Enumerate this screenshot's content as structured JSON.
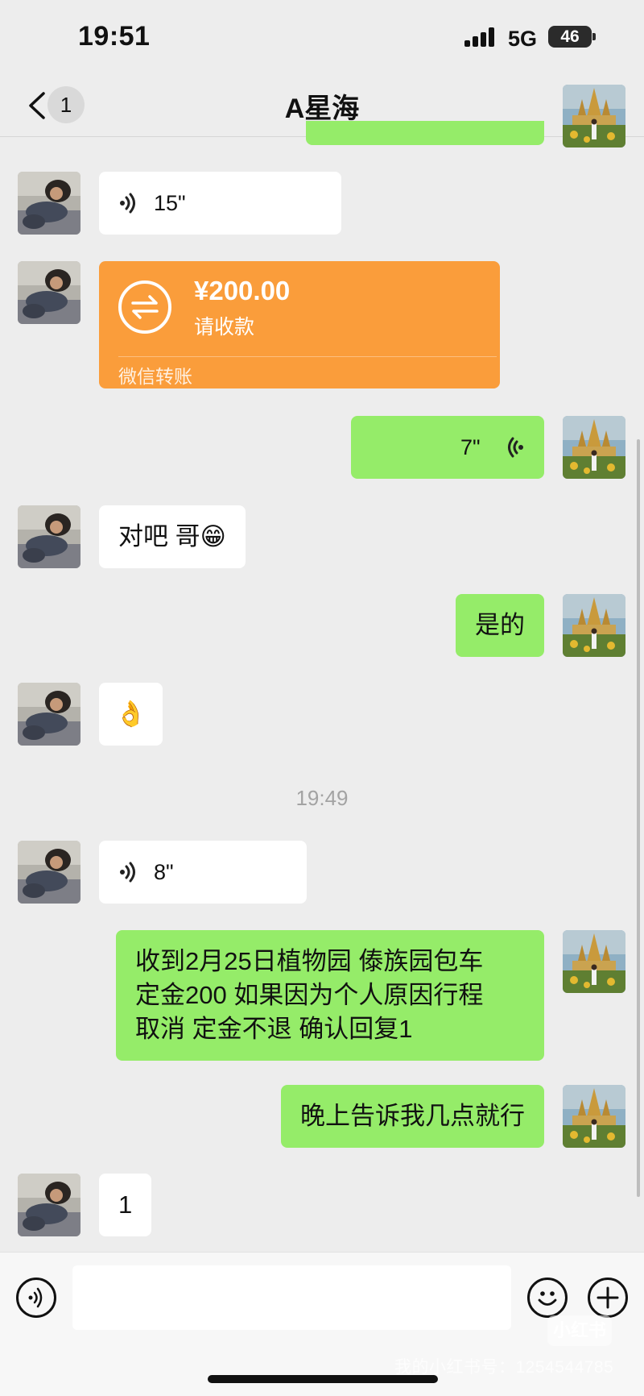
{
  "status_bar": {
    "time": "19:51",
    "network": "5G",
    "battery": "46"
  },
  "nav": {
    "back_count": "1",
    "title": "A星海",
    "back_icon": "chevron-left-icon",
    "more_icon": "more-dots-icon"
  },
  "colors": {
    "background": "#ededed",
    "self_bubble": "#95ec69",
    "other_bubble": "#ffffff",
    "transfer": "#fa9d3b"
  },
  "messages": [
    {
      "side": "self",
      "type": "green-strip"
    },
    {
      "side": "other",
      "type": "voice",
      "duration": "15\""
    },
    {
      "side": "other",
      "type": "transfer",
      "amount": "¥200.00",
      "note": "请收款",
      "label": "微信转账"
    },
    {
      "side": "self",
      "type": "voice",
      "duration": "7\""
    },
    {
      "side": "other",
      "type": "text",
      "text": "对吧 哥😁"
    },
    {
      "side": "self",
      "type": "text",
      "text": "是的"
    },
    {
      "side": "other",
      "type": "emoji",
      "text": "👌"
    },
    {
      "side": "other",
      "type": "voice",
      "duration": "8\""
    },
    {
      "side": "self",
      "type": "text",
      "lines": [
        "收到2月25日植物园 傣族园包车",
        "定金200 如果因为个人原因行程",
        "取消 定金不退 确认回复1"
      ]
    },
    {
      "side": "self",
      "type": "text",
      "text": "晚上告诉我几点就行"
    },
    {
      "side": "other",
      "type": "text",
      "text": "1"
    }
  ],
  "timestamp": "19:49",
  "input_bar": {
    "voice_icon": "voice-icon",
    "emoji_icon": "emoji-icon",
    "plus_icon": "plus-icon"
  },
  "watermark": {
    "logo": "小红书",
    "text": "我的小红书号：1254544785"
  }
}
